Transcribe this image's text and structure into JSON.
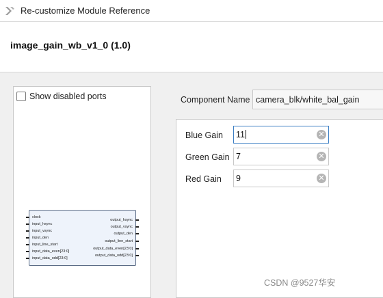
{
  "window": {
    "title": "Re-customize Module Reference"
  },
  "header": {
    "module_name": "image_gain_wb_v1_0 (1.0)"
  },
  "symbol_panel": {
    "show_disabled_ports_label": "Show disabled ports",
    "show_disabled_ports_checked": false,
    "input_ports": [
      "clock",
      "input_hsync",
      "input_vsync",
      "input_den",
      "input_line_start",
      "input_data_even[23:0]",
      "input_data_odd[23:0]"
    ],
    "output_ports": [
      "output_hsync",
      "output_vsync",
      "output_den",
      "output_line_start",
      "output_data_even[23:0]",
      "output_data_odd[23:0]"
    ]
  },
  "component": {
    "label": "Component Name",
    "value": "camera_blk/white_bal_gain"
  },
  "params": [
    {
      "label": "Blue Gain",
      "value": "11",
      "focused": true
    },
    {
      "label": "Green Gain",
      "value": "7",
      "focused": false
    },
    {
      "label": "Red Gain",
      "value": "9",
      "focused": false
    }
  ],
  "watermark": "CSDN @9527华安",
  "colors": {
    "focus_border": "#3c7fc4",
    "block_fill": "#eef3fb",
    "logo": "#9a9a9a"
  }
}
